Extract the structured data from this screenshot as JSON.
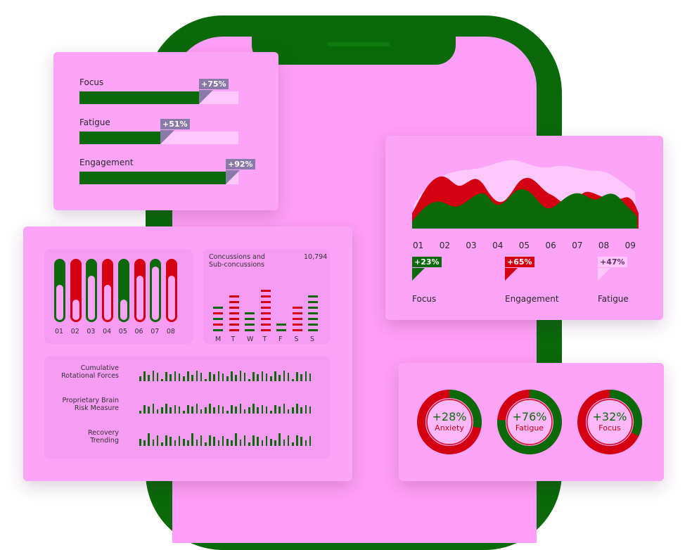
{
  "colors": {
    "green": "#0a6a0a",
    "red": "#d40012",
    "pink": "#fca4f8",
    "slate": "#8a7aa8",
    "light_pink": "#ffc8fb"
  },
  "progress_card": {
    "items": [
      {
        "label": "Focus",
        "badge": "+75%",
        "value": 0.75
      },
      {
        "label": "Fatigue",
        "badge": "+51%",
        "value": 0.51
      },
      {
        "label": "Engagement",
        "badge": "+92%",
        "value": 0.92
      }
    ]
  },
  "area_chart": {
    "x_labels": [
      "01",
      "02",
      "03",
      "04",
      "05",
      "06",
      "07",
      "08",
      "09"
    ],
    "series": [
      {
        "label": "Focus",
        "badge": "+23%"
      },
      {
        "label": "Engagement",
        "badge": "+65%"
      },
      {
        "label": "Fatigue",
        "badge": "+47%"
      }
    ]
  },
  "tube_chart": {
    "labels": [
      "01",
      "02",
      "03",
      "04",
      "05",
      "06",
      "07",
      "08"
    ],
    "colors": [
      "green",
      "red",
      "green",
      "red",
      "green",
      "red",
      "green",
      "red"
    ],
    "fill_levels": [
      0.6,
      0.35,
      0.75,
      0.6,
      0.35,
      0.75,
      0.9,
      0.75
    ]
  },
  "concussions": {
    "title_line1": "Concussions and",
    "title_line2": "Sub-concussions",
    "count": "10,794",
    "days": [
      "M",
      "T",
      "W",
      "T",
      "F",
      "S",
      "S"
    ]
  },
  "metrics": [
    {
      "line1": "Cumulative",
      "line2": "Rotational Forces"
    },
    {
      "line1": "Proprietary Brain",
      "line2": "Risk Measure"
    },
    {
      "line1": "Recovery",
      "line2": "Trending"
    }
  ],
  "donuts": [
    {
      "value": "+28%",
      "label": "Anxiety",
      "fill": 0.28
    },
    {
      "value": "+76%",
      "label": "Fatigue",
      "fill": 0.76
    },
    {
      "value": "+32%",
      "label": "Focus",
      "fill": 0.32
    }
  ]
}
